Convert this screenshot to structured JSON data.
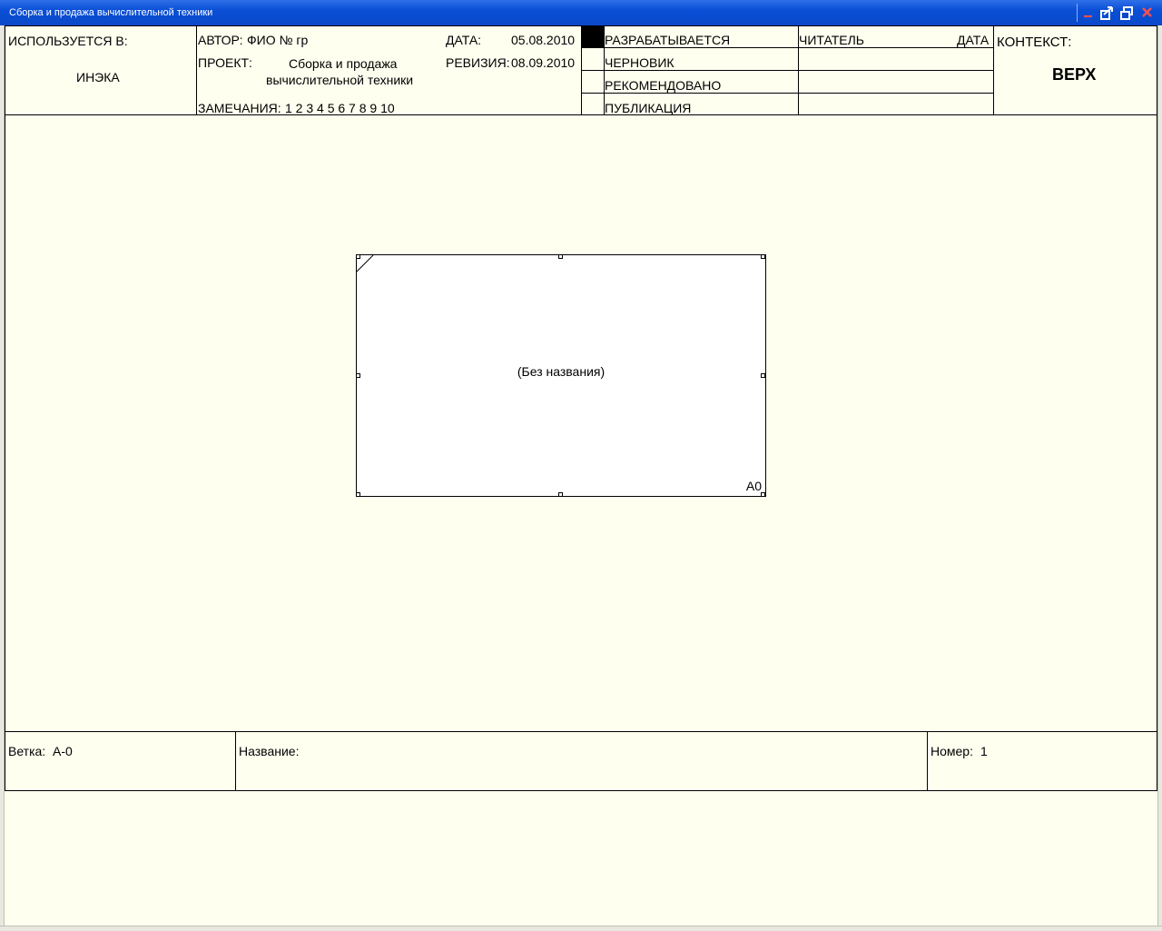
{
  "window": {
    "title": "Сборка и продажа вычислительной техники",
    "minimize_icon": "minimize-icon",
    "restore_icon": "restore-icon",
    "close_icon": "close-icon"
  },
  "header": {
    "used_in_label": "ИСПОЛЬЗУЕТСЯ В:",
    "used_in_value": "ИНЭКА",
    "author_label": "АВТОР:",
    "author_value": "ФИО № гр",
    "date_label": "ДАТА:",
    "date_value": "05.08.2010",
    "project_label": "ПРОЕКТ:",
    "project_line1": "Сборка и продажа",
    "project_line2": "вычислительной техники",
    "revision_label": "РЕВИЗИЯ:",
    "revision_value": "08.09.2010",
    "notes_label": "ЗАМЕЧАНИЯ:",
    "notes_values": "1 2 3 4 5 6 7 8 9 10",
    "status": [
      "РАЗРАБАТЫВАЕТСЯ",
      "ЧЕРНОВИК",
      "РЕКОМЕНДОВАНО",
      "ПУБЛИКАЦИЯ"
    ],
    "reader_label": "ЧИТАТЕЛЬ",
    "reader_date_label": "ДАТА",
    "context_label": "КОНТЕКСТ:",
    "context_value": "ВЕРХ"
  },
  "diagram": {
    "box_label": "(Без названия)",
    "box_number": "А0"
  },
  "footer": {
    "node_label": "Ветка:",
    "node_value": "А-0",
    "title_label": "Название:",
    "title_value": "",
    "number_label": "Номер:",
    "number_value": "1"
  }
}
